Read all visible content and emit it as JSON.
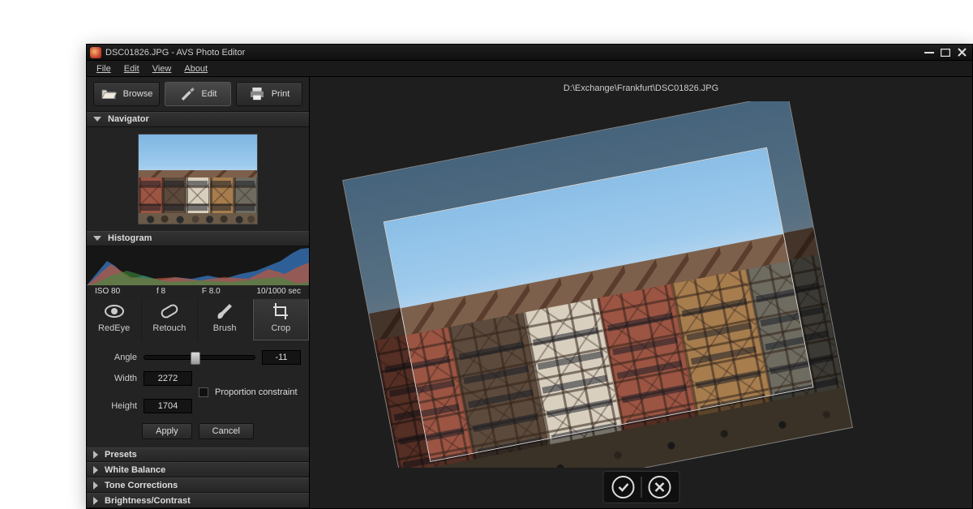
{
  "window": {
    "filename": "DSC01826.JPG",
    "separator": "  -  ",
    "app_name": "AVS Photo Editor"
  },
  "menu": {
    "file": "File",
    "edit": "Edit",
    "view": "View",
    "about": "About"
  },
  "toolbar": {
    "browse": "Browse",
    "edit": "Edit",
    "print": "Print"
  },
  "sections": {
    "navigator": "Navigator",
    "histogram": "Histogram",
    "presets": "Presets",
    "white_balance": "White Balance",
    "tone_corrections": "Tone Corrections",
    "brightness_contrast": "Brightness/Contrast"
  },
  "histogram_readout": {
    "iso": "ISO 80",
    "fnum_short": "f 8",
    "fnum_long": "F 8.0",
    "shutter": "10/1000 sec"
  },
  "tools": {
    "redeye": "RedEye",
    "retouch": "Retouch",
    "brush": "Brush",
    "crop": "Crop"
  },
  "crop_controls": {
    "angle_label": "Angle",
    "angle_value": "-11",
    "width_label": "Width",
    "width_value": "2272",
    "height_label": "Height",
    "height_value": "1704",
    "proportion_label": "Proportion constraint",
    "apply": "Apply",
    "cancel": "Cancel"
  },
  "content": {
    "filepath": "D:\\Exchange\\Frankfurt\\DSC01826.JPG"
  },
  "icons": {
    "browse": "folder-open-icon",
    "edit": "brush-pen-icon",
    "print": "printer-icon",
    "redeye": "eye-icon",
    "retouch": "bandage-icon",
    "brush": "paintbrush-icon",
    "crop": "crop-icon",
    "accept": "check-circle-icon",
    "reject": "x-circle-icon"
  }
}
